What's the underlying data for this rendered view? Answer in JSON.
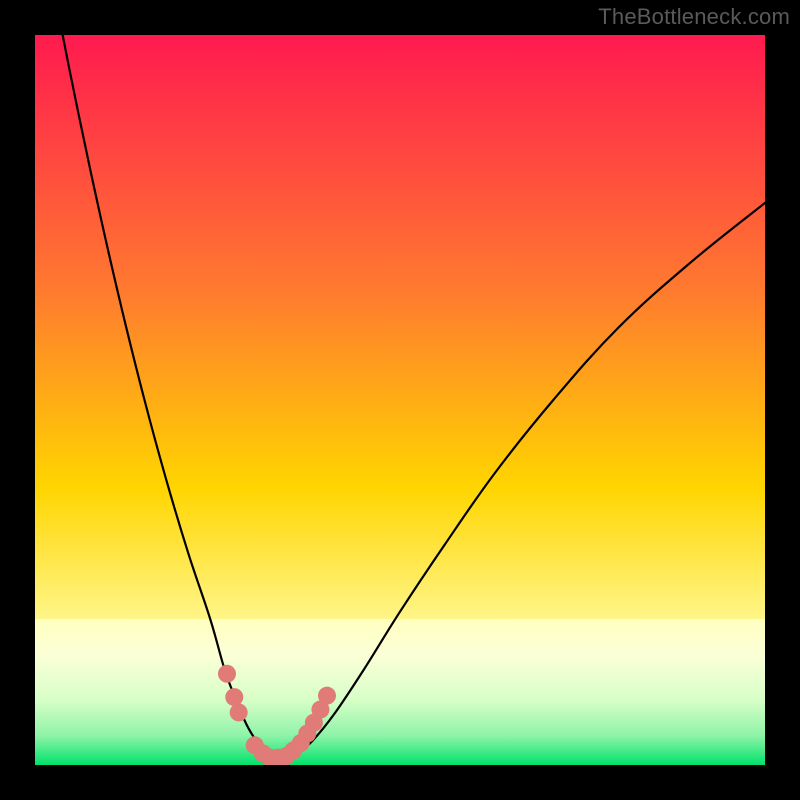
{
  "watermark": "TheBottleneck.com",
  "colors": {
    "frame": "#000000",
    "gradient_top": "#ff1a4f",
    "gradient_mid1": "#ff7a2f",
    "gradient_mid2": "#ffd500",
    "gradient_low1": "#fffb9f",
    "gradient_low2": "#d6ffae",
    "gradient_bottom": "#00e26b",
    "curve": "#000000",
    "markers": "#e07b78"
  },
  "chart_data": {
    "type": "line",
    "title": "",
    "xlabel": "",
    "ylabel": "",
    "xlim": [
      0,
      100
    ],
    "ylim": [
      0,
      100
    ],
    "series": [
      {
        "name": "bottleneck-curve",
        "x": [
          0,
          3,
          6,
          9,
          12,
          15,
          18,
          21,
          24,
          26,
          27.5,
          29,
          30.5,
          31.5,
          33,
          34.5,
          36,
          38,
          41,
          45,
          50,
          56,
          63,
          71,
          80,
          90,
          100
        ],
        "values": [
          120,
          104,
          89,
          75,
          62,
          50,
          39,
          29,
          20,
          13,
          9,
          5.5,
          3,
          1.6,
          0.8,
          0.8,
          1.6,
          3.3,
          7,
          13,
          21,
          30,
          40,
          50,
          60,
          69,
          77
        ]
      }
    ],
    "markers": {
      "name": "highlight-dots",
      "points_xy": [
        [
          26.3,
          12.5
        ],
        [
          27.3,
          9.3
        ],
        [
          27.9,
          7.2
        ],
        [
          30.1,
          2.7
        ],
        [
          31.2,
          1.6
        ],
        [
          32.2,
          1.0
        ],
        [
          33.3,
          1.0
        ],
        [
          34.4,
          1.2
        ],
        [
          35.4,
          2.0
        ],
        [
          36.4,
          3.0
        ],
        [
          37.3,
          4.3
        ],
        [
          38.2,
          5.8
        ],
        [
          39.1,
          7.6
        ],
        [
          40.0,
          9.5
        ]
      ],
      "radius": 9
    },
    "desaturated_band_y": [
      0,
      20
    ]
  }
}
